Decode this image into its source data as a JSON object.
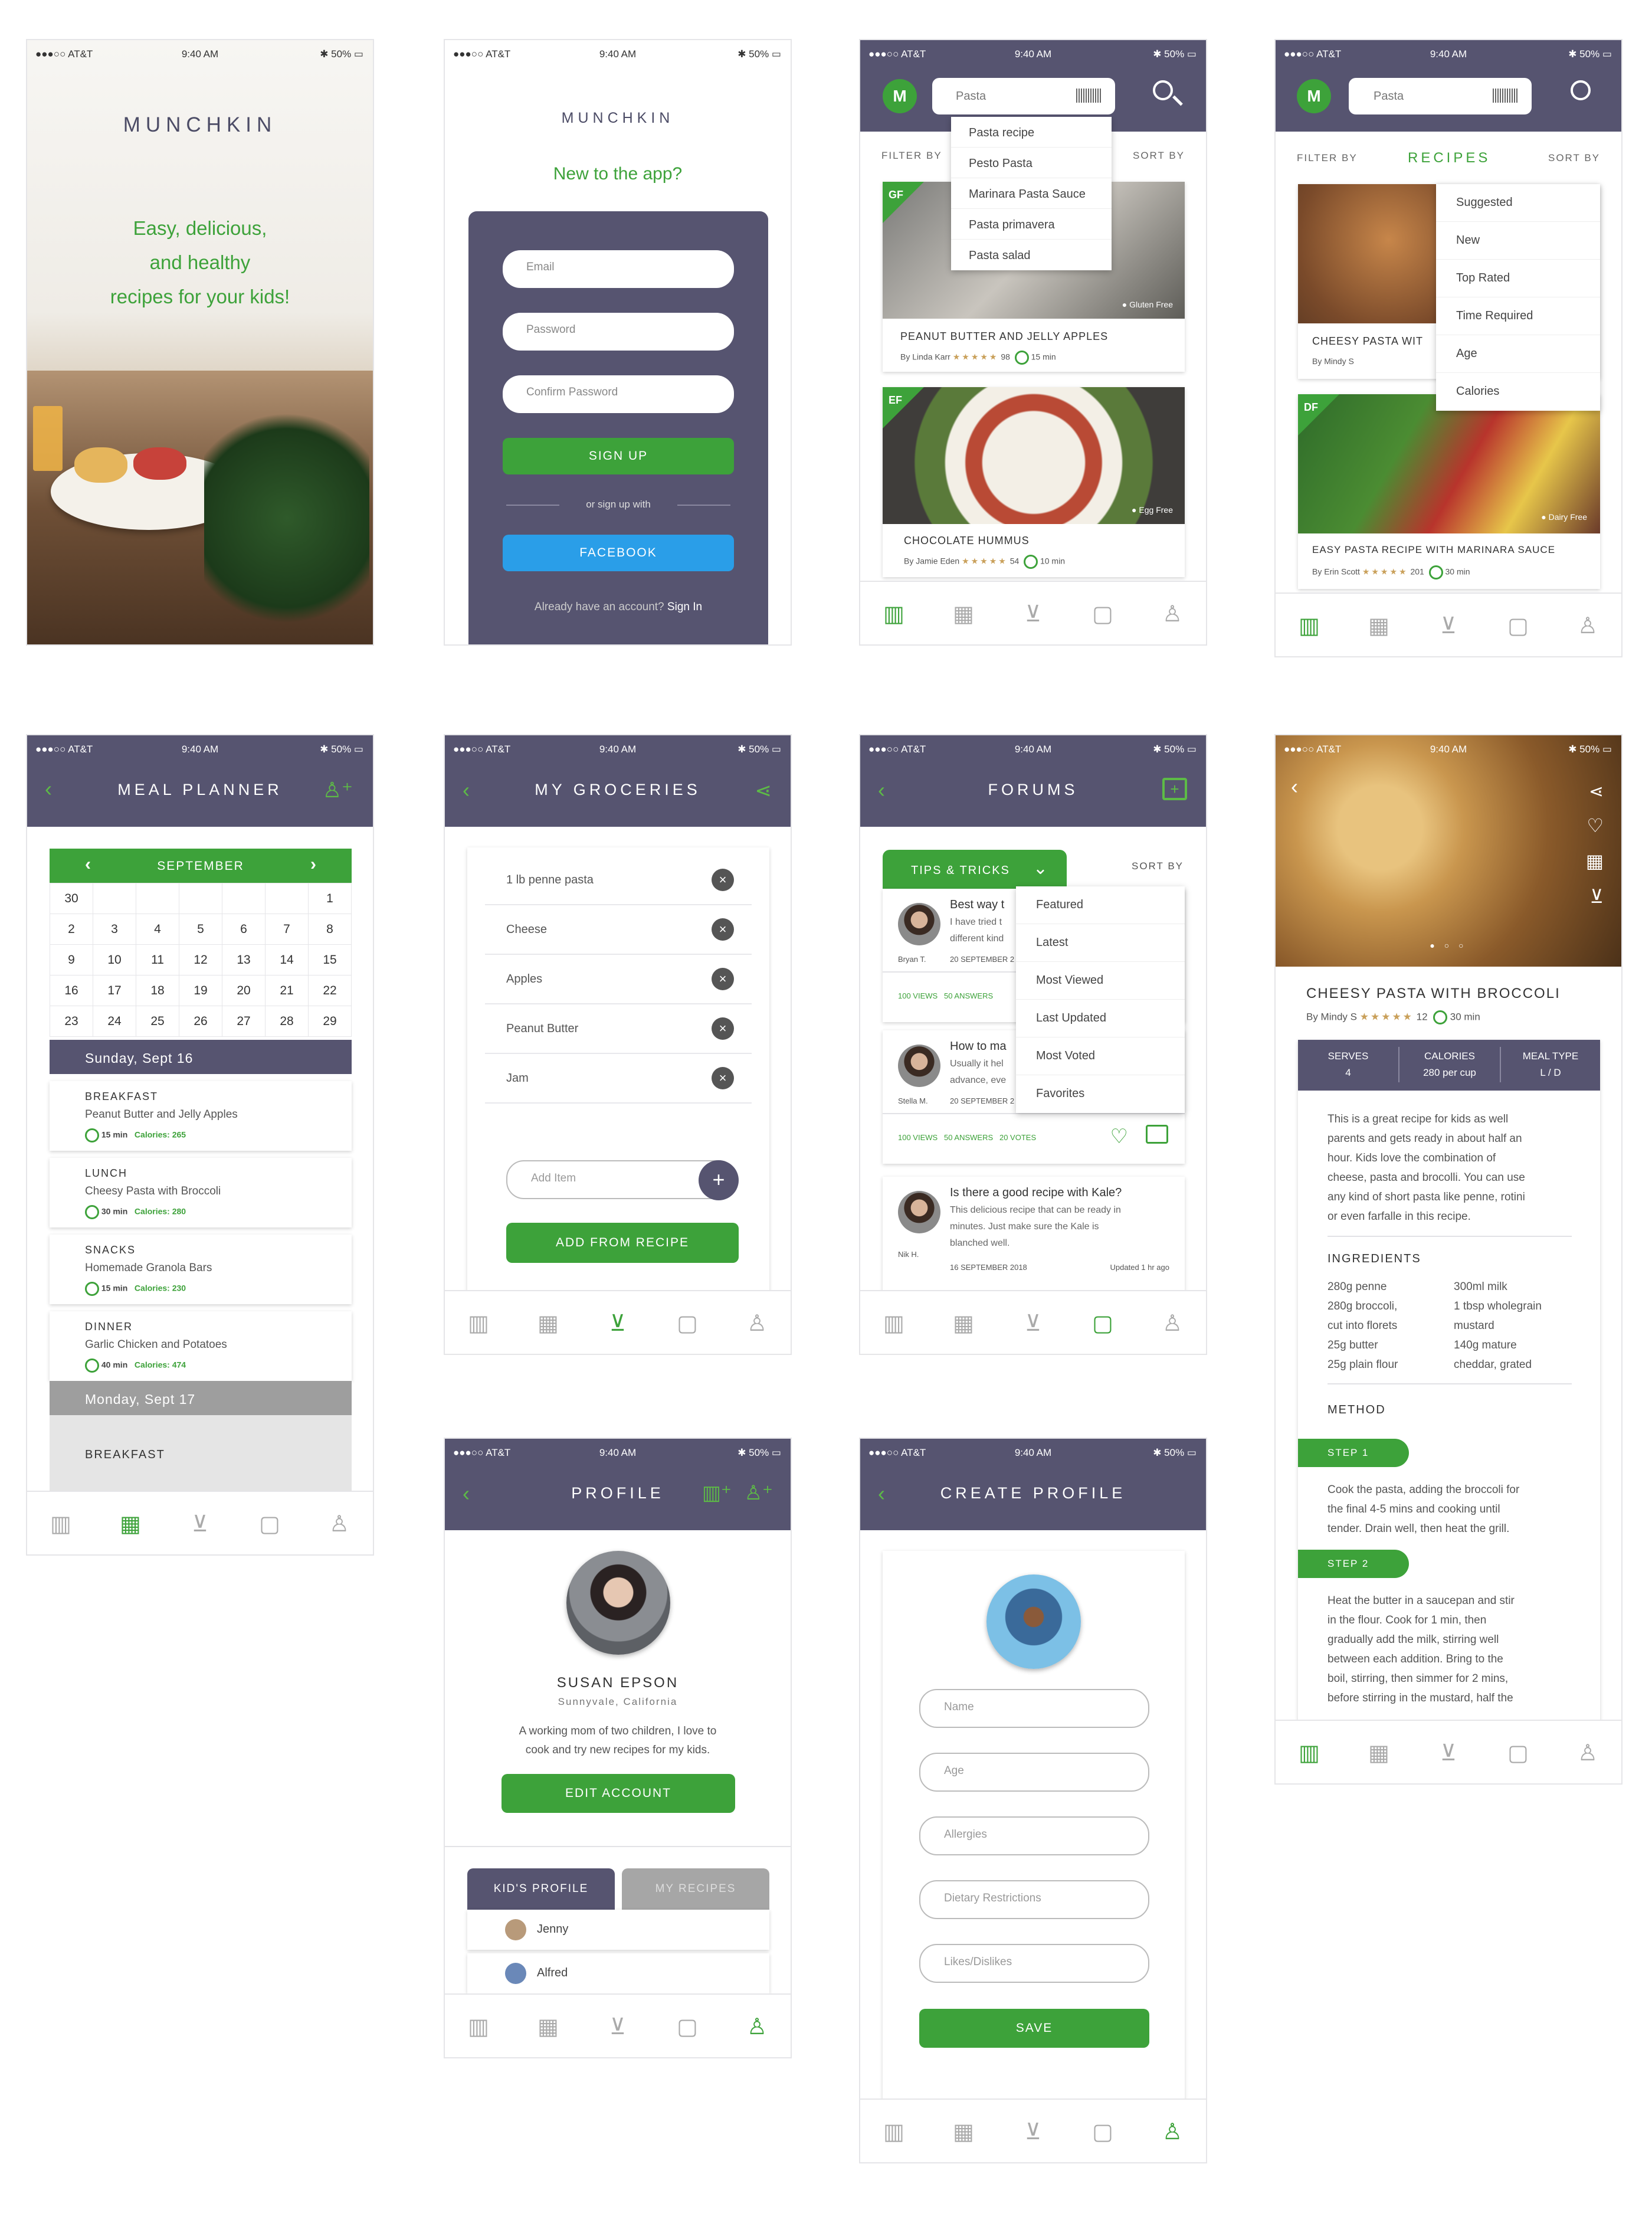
{
  "status": {
    "carrier": "●●●○○ AT&T",
    "time": "9:40 AM",
    "battery": "50%"
  },
  "splash": {
    "logo": "MUNCHKIN",
    "tagline_1": "Easy, delicious,",
    "tagline_2": "and healthy",
    "tagline_3": "recipes for your kids!"
  },
  "signup": {
    "logo": "MUNCHKIN",
    "headline": "New to the app?",
    "email": "Email",
    "password": "Password",
    "confirm": "Confirm Password",
    "signup_btn": "SIGN UP",
    "or": "or sign up with",
    "facebook": "FACEBOOK",
    "have_account": "Already have an account?",
    "sign_in": "Sign In"
  },
  "search": {
    "logo": "M",
    "query": "Pasta",
    "filter": "FILTER BY",
    "sort": "SORT BY",
    "suggestions": [
      "Pasta recipe",
      "Pesto Pasta",
      "Marinara Pasta Sauce",
      "Pasta primavera",
      "Pasta salad"
    ],
    "cards": [
      {
        "badge": "GF",
        "tag": "Gluten Free",
        "title": "PEANUT BUTTER AND JELLY APPLES",
        "author": "By Linda Karr",
        "rating": "98",
        "time": "15 min"
      },
      {
        "badge": "EF",
        "tag": "Egg Free",
        "title": "CHOCOLATE HUMMUS",
        "author": "By Jamie Eden",
        "rating": "54",
        "time": "10 min"
      }
    ]
  },
  "recipes": {
    "logo": "M",
    "query": "Pasta",
    "filter": "FILTER BY",
    "title": "RECIPES",
    "sort": "SORT BY",
    "sort_options": [
      "Suggested",
      "New",
      "Top Rated",
      "Time Required",
      "Age",
      "Calories"
    ],
    "cards": [
      {
        "title": "CHEESY PASTA WIT",
        "author": "By Mindy S"
      },
      {
        "badge": "DF",
        "tag": "Dairy Free",
        "title": "EASY PASTA RECIPE WITH MARINARA SAUCE",
        "author": "By Erin Scott",
        "rating": "201",
        "time": "30 min"
      }
    ]
  },
  "planner": {
    "title": "MEAL PLANNER",
    "month": "SEPTEMBER",
    "weeks": [
      [
        "30",
        "",
        "",
        "",
        "",
        "",
        "1"
      ],
      [
        "2",
        "3",
        "4",
        "5",
        "6",
        "7",
        "8"
      ],
      [
        "9",
        "10",
        "11",
        "12",
        "13",
        "14",
        "15"
      ],
      [
        "16",
        "17",
        "18",
        "19",
        "20",
        "21",
        "22"
      ],
      [
        "23",
        "24",
        "25",
        "26",
        "27",
        "28",
        "29"
      ]
    ],
    "day1": "Sunday, Sept 16",
    "meals": [
      {
        "type": "BREAKFAST",
        "name": "Peanut Butter and Jelly Apples",
        "time": "15 min",
        "cal": "Calories: 265"
      },
      {
        "type": "LUNCH",
        "name": "Cheesy Pasta with Broccoli",
        "time": "30 min",
        "cal": "Calories: 280"
      },
      {
        "type": "SNACKS",
        "name": "Homemade Granola Bars",
        "time": "15 min",
        "cal": "Calories: 230"
      },
      {
        "type": "DINNER",
        "name": "Garlic Chicken and Potatoes",
        "time": "40 min",
        "cal": "Calories: 474"
      }
    ],
    "day2": "Monday, Sept 17",
    "next": "BREAKFAST"
  },
  "groceries": {
    "title": "MY GROCERIES",
    "items": [
      "1 lb penne pasta",
      "Cheese",
      "Apples",
      "Peanut Butter",
      "Jam"
    ],
    "add_placeholder": "Add Item",
    "add_recipe": "ADD FROM RECIPE"
  },
  "forums": {
    "title": "FORUMS",
    "tab": "TIPS & TRICKS",
    "sort": "SORT BY",
    "sort_options": [
      "Featured",
      "Latest",
      "Most Viewed",
      "Last Updated",
      "Most Voted",
      "Favorites"
    ],
    "posts": [
      {
        "title": "Best way t",
        "body1": "I have tried t",
        "body2": "different kind",
        "user": "Bryan T.",
        "date": "20 SEPTEMBER 2",
        "views": "100 VIEWS",
        "answers": "50 ANSWERS"
      },
      {
        "title": "How to ma",
        "body1": "Usually it hel",
        "body2": "advance, eve",
        "user": "Stella M.",
        "date": "20 SEPTEMBER 2",
        "views": "100 VIEWS",
        "answers": "50 ANSWERS",
        "votes": "20 VOTES"
      },
      {
        "title": "Is there a good recipe with Kale?",
        "body1": "This delicious recipe that can be ready in",
        "body2": "minutes. Just make sure the Kale is",
        "body3": "blanched well.",
        "user": "Nik H.",
        "date": "16 SEPTEMBER 2018",
        "updated": "Updated 1 hr ago"
      }
    ]
  },
  "detail": {
    "title": "CHEESY PASTA WITH BROCCOLI",
    "author": "By Mindy S",
    "rating": "12",
    "time": "30 min",
    "stats": [
      {
        "label": "SERVES",
        "value": "4"
      },
      {
        "label": "CALORIES",
        "value": "280 per cup"
      },
      {
        "label": "MEAL TYPE",
        "value": "L / D"
      }
    ],
    "desc": [
      "This is a great recipe for kids as well",
      "parents and gets ready in about half an",
      "hour. Kids love the combination of",
      "cheese, pasta and brocolli. You can use",
      "any kind of short pasta like penne, rotini",
      "or even farfalle in this recipe."
    ],
    "ing_title": "INGREDIENTS",
    "ing_left": [
      "280g penne",
      "280g broccoli,",
      "cut into florets",
      "25g butter",
      "25g plain flour"
    ],
    "ing_right": [
      "300ml milk",
      "1 tbsp wholegrain",
      "mustard",
      "140g mature",
      "cheddar, grated"
    ],
    "method": "METHOD",
    "step1": "STEP 1",
    "step1_text": [
      "Cook the pasta, adding the broccoli for",
      "the final 4-5 mins and cooking until",
      "tender. Drain well, then heat the grill."
    ],
    "step2": "STEP 2",
    "step2_text": [
      "Heat the butter in a saucepan and stir",
      "in the flour. Cook for 1 min, then",
      "gradually add the milk, stirring well",
      "between each addition. Bring to the",
      "boil, stirring, then simmer for 2 mins,",
      "before stirring in the mustard, half the"
    ]
  },
  "profile": {
    "title": "PROFILE",
    "name": "SUSAN EPSON",
    "location": "Sunnyvale, California",
    "bio1": "A working mom of two children, I love to",
    "bio2": "cook and try new recipes for my kids.",
    "edit": "EDIT ACCOUNT",
    "tab1": "KID'S PROFILE",
    "tab2": "MY RECIPES",
    "kids": [
      "Jenny",
      "Alfred"
    ]
  },
  "create": {
    "title": "CREATE PROFILE",
    "fields": [
      "Name",
      "Age",
      "Allergies",
      "Dietary Restrictions",
      "Likes/Dislikes"
    ],
    "save": "SAVE"
  },
  "colors": {
    "header": "#565470",
    "green": "#3da23a",
    "facebook": "#2a9ee8"
  }
}
